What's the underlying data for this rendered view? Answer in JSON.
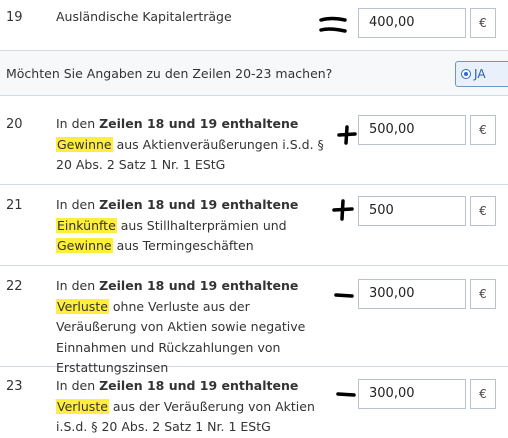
{
  "rows": [
    {
      "number": "19",
      "parts": [
        {
          "t": "Ausländische Kapitalerträge",
          "b": false,
          "hl": false
        }
      ],
      "value": "400,00",
      "unit": "€",
      "mark": "="
    },
    {
      "number": "20",
      "parts": [
        {
          "t": "In den ",
          "b": false,
          "hl": false
        },
        {
          "t": "Zeilen 18 und 19 enthaltene",
          "b": true,
          "hl": false
        },
        {
          "t": " ",
          "b": false,
          "hl": false
        },
        {
          "t": "Gewinne",
          "b": false,
          "hl": true
        },
        {
          "t": " aus Aktienveräußerungen i.S.d. § 20 Abs. 2 Satz 1 Nr. 1 EStG",
          "b": false,
          "hl": false
        }
      ],
      "value": "500,00",
      "unit": "€",
      "mark": "+"
    },
    {
      "number": "21",
      "parts": [
        {
          "t": "In den ",
          "b": false,
          "hl": false
        },
        {
          "t": "Zeilen 18 und 19 enthaltene",
          "b": true,
          "hl": false
        },
        {
          "t": " ",
          "b": false,
          "hl": false
        },
        {
          "t": "Einkünfte",
          "b": false,
          "hl": true
        },
        {
          "t": " aus Stillhalterprämien und ",
          "b": false,
          "hl": false
        },
        {
          "t": "Gewinne",
          "b": false,
          "hl": true
        },
        {
          "t": " aus Termingeschäften",
          "b": false,
          "hl": false
        }
      ],
      "value": "500",
      "unit": "€",
      "mark": "+"
    },
    {
      "number": "22",
      "parts": [
        {
          "t": "In den ",
          "b": false,
          "hl": false
        },
        {
          "t": "Zeilen 18 und 19 enthaltene",
          "b": true,
          "hl": false
        },
        {
          "t": " ",
          "b": false,
          "hl": false
        },
        {
          "t": "Verluste",
          "b": false,
          "hl": true
        },
        {
          "t": " ohne Verluste aus der Veräußerung von Aktien sowie negative Einnahmen und Rückzahlungen von Erstattungszinsen",
          "b": false,
          "hl": false
        }
      ],
      "value": "300,00",
      "unit": "€",
      "mark": "-"
    },
    {
      "number": "23",
      "parts": [
        {
          "t": "In den ",
          "b": false,
          "hl": false
        },
        {
          "t": "Zeilen 18 und 19 enthaltene",
          "b": true,
          "hl": false
        },
        {
          "t": " ",
          "b": false,
          "hl": false
        },
        {
          "t": "Verluste",
          "b": false,
          "hl": true
        },
        {
          "t": " aus der Veräußerung von Aktien i.S.d. § 20 Abs. 2 Satz 1 Nr. 1 EStG",
          "b": false,
          "hl": false
        }
      ],
      "value": "300,00",
      "unit": "€",
      "mark": "-"
    }
  ],
  "question": {
    "text": "Möchten Sie Angaben zu den Zeilen 20-23 machen?",
    "option_label": "JA"
  },
  "colors": {
    "highlight": "#ffef3a",
    "accent": "#2a6acb",
    "border": "#b9c3cd"
  }
}
